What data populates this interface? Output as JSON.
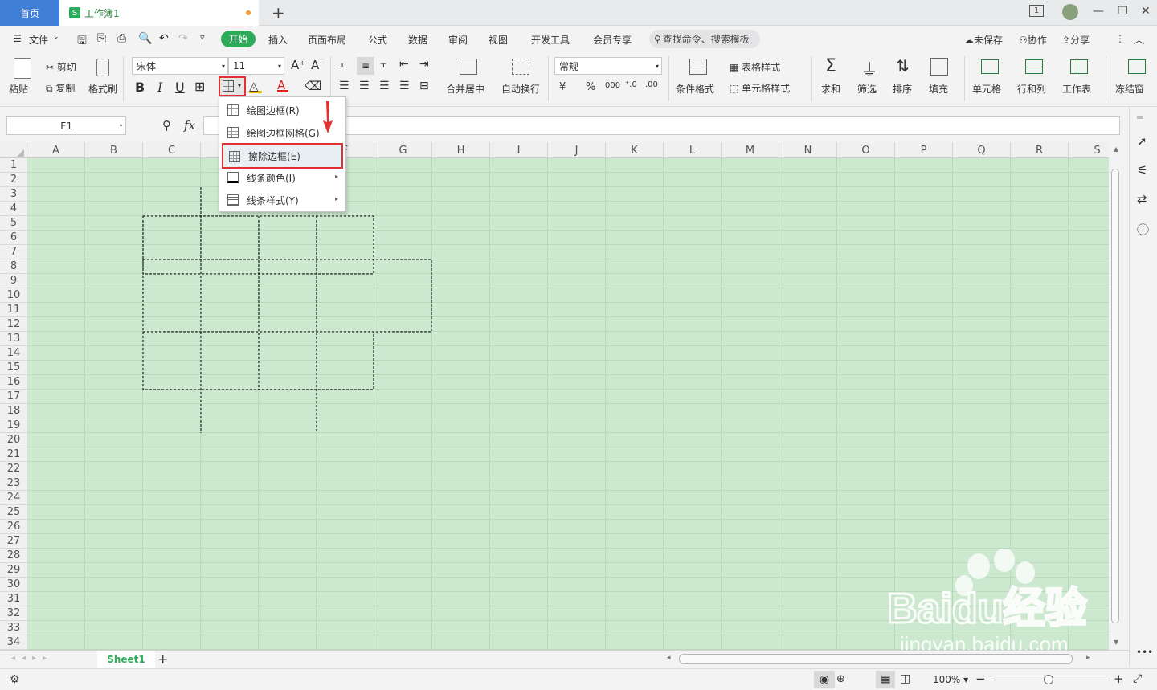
{
  "tabs": {
    "home": "首页",
    "workbook": "工作簿1",
    "workbook_icon": "S"
  },
  "menu": {
    "file": "文件",
    "items": [
      "开始",
      "插入",
      "页面布局",
      "公式",
      "数据",
      "审阅",
      "视图",
      "开发工具",
      "会员专享"
    ],
    "search": "查找命令、搜索模板",
    "unsaved": "未保存",
    "collab": "协作",
    "share": "分享"
  },
  "ribbon": {
    "paste": "粘贴",
    "cut": "剪切",
    "copy": "复制",
    "format_painter": "格式刷",
    "font": "宋体",
    "size": "11",
    "merge": "合并居中",
    "wrap": "自动换行",
    "number_format": "常规",
    "cond_format": "条件格式",
    "table_style": "表格样式",
    "cell_style": "单元格样式",
    "sum": "求和",
    "filter": "筛选",
    "sort": "排序",
    "fill": "填充",
    "cell": "单元格",
    "rowcol": "行和列",
    "sheet": "工作表",
    "freeze": "冻结窗"
  },
  "formula": {
    "namebox": "E1",
    "fx": "fx"
  },
  "columns": [
    "A",
    "B",
    "C",
    "D",
    "E",
    "F",
    "G",
    "H",
    "I",
    "J",
    "K",
    "L",
    "M",
    "N",
    "O",
    "P",
    "Q",
    "R",
    "S"
  ],
  "rows": [
    "1",
    "2",
    "3",
    "4",
    "5",
    "6",
    "7",
    "8",
    "9",
    "10",
    "11",
    "12",
    "13",
    "14",
    "15",
    "16",
    "17",
    "18",
    "19",
    "20",
    "21",
    "22",
    "23",
    "24",
    "25",
    "26",
    "27",
    "28",
    "29",
    "30",
    "31",
    "32",
    "33",
    "34"
  ],
  "dropdown": [
    {
      "label": "绘图边框(R)",
      "sub": false
    },
    {
      "label": "绘图边框网格(G)",
      "sub": false
    },
    {
      "label": "擦除边框(E)",
      "sub": false
    },
    {
      "label": "线条颜色(I)",
      "sub": true
    },
    {
      "label": "线条样式(Y)",
      "sub": true
    }
  ],
  "sheets": {
    "active": "Sheet1"
  },
  "statusbar": {
    "zoom": "100%"
  },
  "watermark": {
    "brand": "Baidu经验",
    "url": "jingyan.baidu.com"
  },
  "colors": {
    "accent": "#2eab5a",
    "highlight": "#e03030",
    "cell_bg": "#cce8cf"
  }
}
